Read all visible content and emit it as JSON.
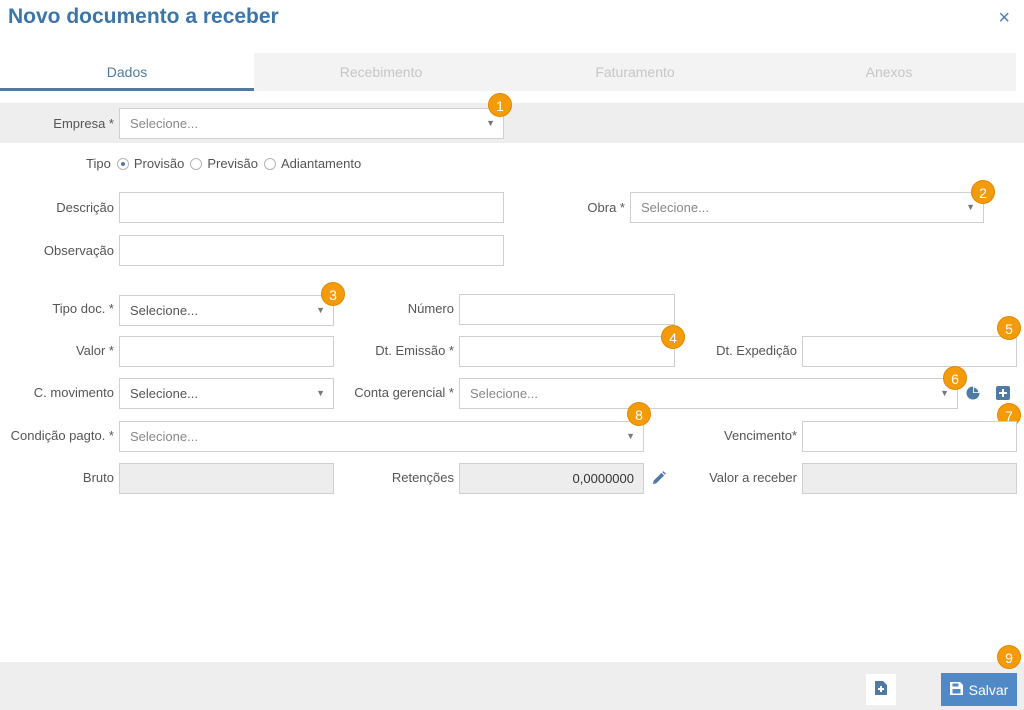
{
  "header": {
    "title": "Novo documento a receber",
    "close_icon": "×"
  },
  "tabs": [
    {
      "label": "Dados",
      "active": true
    },
    {
      "label": "Recebimento",
      "active": false
    },
    {
      "label": "Faturamento",
      "active": false
    },
    {
      "label": "Anexos",
      "active": false
    }
  ],
  "form": {
    "empresa": {
      "label": "Empresa *",
      "placeholder": "Selecione..."
    },
    "tipo": {
      "label": "Tipo",
      "options": [
        "Provisão",
        "Previsão",
        "Adiantamento"
      ],
      "selected": "Provisão"
    },
    "descricao": {
      "label": "Descrição",
      "value": ""
    },
    "observacao": {
      "label": "Observação",
      "value": ""
    },
    "obra": {
      "label": "Obra *",
      "placeholder": "Selecione..."
    },
    "tipo_doc": {
      "label": "Tipo doc. *",
      "placeholder": "Selecione..."
    },
    "numero": {
      "label": "Número",
      "value": ""
    },
    "valor": {
      "label": "Valor *",
      "value": ""
    },
    "dt_emissao": {
      "label": "Dt. Emissão *",
      "value": ""
    },
    "dt_expedicao": {
      "label": "Dt. Expedição",
      "value": ""
    },
    "c_movimento": {
      "label": "C. movimento",
      "placeholder": "Selecione..."
    },
    "conta_gerencial": {
      "label": "Conta gerencial *",
      "placeholder": "Selecione..."
    },
    "condicao_pagto": {
      "label": "Condição pagto. *",
      "placeholder": "Selecione..."
    },
    "vencimento": {
      "label": "Vencimento*",
      "value": ""
    },
    "bruto": {
      "label": "Bruto",
      "value": ""
    },
    "retencoes": {
      "label": "Retenções",
      "value": "0,0000000"
    },
    "valor_a_receber": {
      "label": "Valor a receber",
      "value": ""
    }
  },
  "badges": [
    "1",
    "2",
    "3",
    "4",
    "5",
    "6",
    "7",
    "8",
    "9"
  ],
  "footer": {
    "save_label": "Salvar"
  },
  "colors": {
    "accent": "#4f7aa3",
    "title": "#3d75a8",
    "badge": "#f49b0b",
    "save": "#5089c6"
  }
}
